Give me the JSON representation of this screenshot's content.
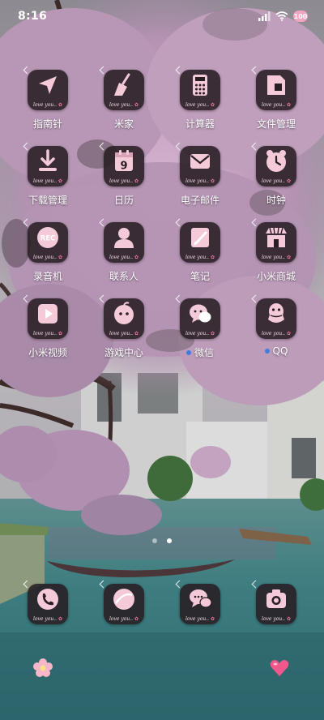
{
  "status_bar": {
    "time": "8:16",
    "battery_level": "100",
    "icons": [
      "signal-icon",
      "wifi-icon",
      "battery-icon"
    ]
  },
  "icon_tag": {
    "text": "love you..",
    "dot": "✿"
  },
  "apps": [
    {
      "label": "指南针",
      "icon": "compass-icon"
    },
    {
      "label": "米家",
      "icon": "broom-icon"
    },
    {
      "label": "计算器",
      "icon": "calculator-icon"
    },
    {
      "label": "文件管理",
      "icon": "folder-icon"
    },
    {
      "label": "下载管理",
      "icon": "download-icon"
    },
    {
      "label": "日历",
      "icon": "calendar-icon",
      "glyph_text": "9"
    },
    {
      "label": "电子邮件",
      "icon": "mail-icon"
    },
    {
      "label": "时钟",
      "icon": "alarm-clock-icon"
    },
    {
      "label": "录音机",
      "icon": "recorder-icon",
      "glyph_text": "REC"
    },
    {
      "label": "联系人",
      "icon": "contact-icon"
    },
    {
      "label": "笔记",
      "icon": "note-icon"
    },
    {
      "label": "小米商城",
      "icon": "store-icon"
    },
    {
      "label": "小米视频",
      "icon": "video-icon"
    },
    {
      "label": "游戏中心",
      "icon": "game-center-icon"
    },
    {
      "label": "微信",
      "icon": "wechat-icon",
      "notification": true
    },
    {
      "label": "QQ",
      "icon": "qq-icon",
      "notification": true
    }
  ],
  "pager": {
    "pages": 2,
    "current": 2
  },
  "dock": [
    {
      "name": "phone",
      "icon": "phone-icon"
    },
    {
      "name": "browser",
      "icon": "browser-icon"
    },
    {
      "name": "messages",
      "icon": "message-icon"
    },
    {
      "name": "camera",
      "icon": "camera-icon"
    }
  ],
  "decorations": [
    "flower-icon",
    "heart-icon"
  ],
  "colors": {
    "tile_background": "#281e23",
    "glyph_pink": "#f4c9d8",
    "notification_dot": "#3f7be0",
    "blossom": "#c9a6c4",
    "water": "#3d7d80"
  }
}
